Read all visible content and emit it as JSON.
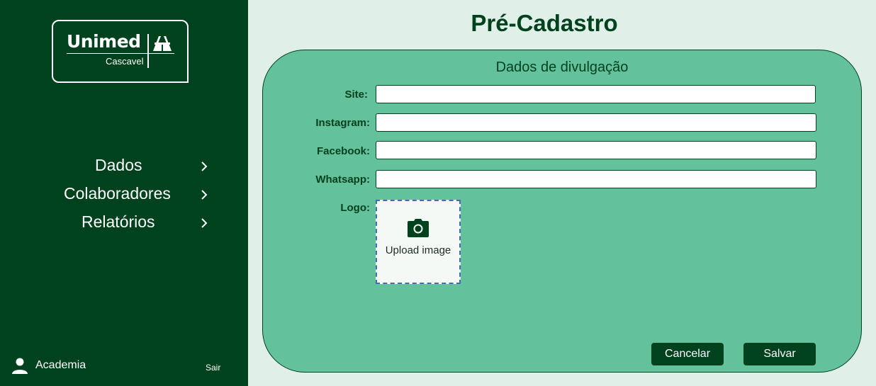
{
  "sidebar": {
    "logo": {
      "brand": "Unimed",
      "city": "Cascavel",
      "icon": "unimed-trees-logo"
    },
    "nav": [
      {
        "label": "Dados",
        "icon": "chevron-right-icon"
      },
      {
        "label": "Colaboradores",
        "icon": "chevron-right-icon"
      },
      {
        "label": "Relatórios",
        "icon": "chevron-right-icon"
      }
    ],
    "user": {
      "name": "Academia",
      "icon": "user-icon"
    },
    "logout_label": "Sair"
  },
  "main": {
    "title": "Pré-Cadastro",
    "card": {
      "section_title": "Dados de divulgação",
      "fields": [
        {
          "label": "Site:",
          "value": ""
        },
        {
          "label": "Instagram:",
          "value": ""
        },
        {
          "label": "Facebook:",
          "value": ""
        },
        {
          "label": "Whatsapp:",
          "value": ""
        }
      ],
      "logo_label": "Logo:",
      "upload": {
        "label": "Upload image",
        "icon": "camera-icon"
      },
      "buttons": {
        "cancel": "Cancelar",
        "save": "Salvar"
      }
    }
  },
  "colors": {
    "sidebar_bg": "#00421e",
    "page_bg": "#e0efe7",
    "card_bg": "#63c19b",
    "accent": "#00421e"
  }
}
